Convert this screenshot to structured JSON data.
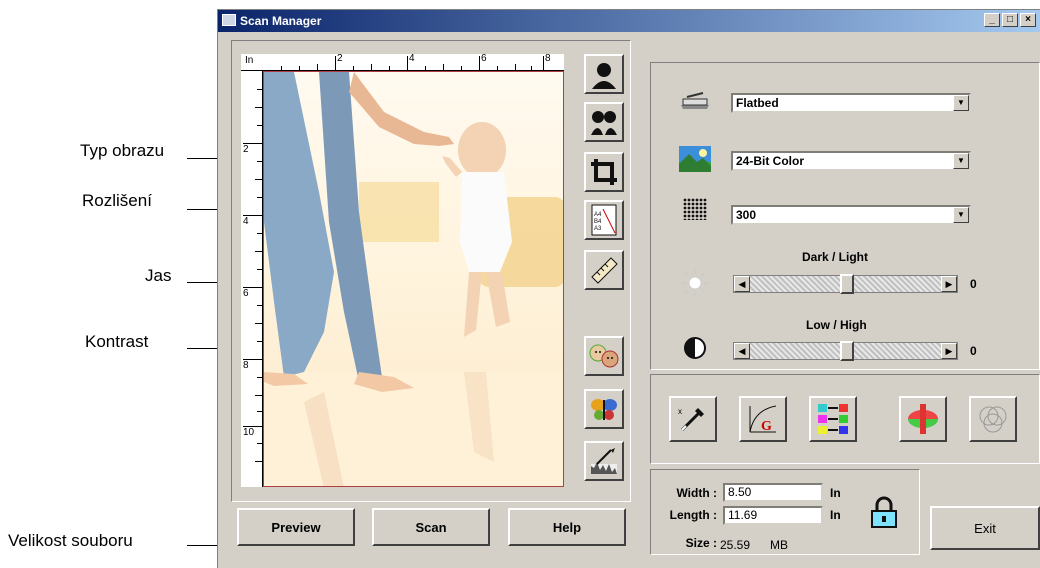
{
  "window": {
    "title": "Scan Manager",
    "controls": [
      "_",
      "□",
      "×"
    ]
  },
  "annotations": {
    "image_type": "Typ obrazu",
    "resolution": "Rozlišení",
    "brightness": "Jas",
    "contrast": "Kontrast",
    "file_size": "Velikost souboru"
  },
  "preview": {
    "ruler_unit": "In",
    "top_ruler_labels": [
      "2",
      "4",
      "6",
      "8"
    ],
    "left_ruler_labels": [
      "2",
      "4",
      "6",
      "8",
      "10"
    ]
  },
  "tools": [
    {
      "icon": "portrait-icon"
    },
    {
      "icon": "mirror-faces-icon"
    },
    {
      "icon": "crop-icon"
    },
    {
      "icon": "paper-size-icon",
      "text": "A4 B4 A3"
    },
    {
      "icon": "ruler-icon"
    },
    {
      "icon": "faces-icon"
    },
    {
      "icon": "butterfly-icon"
    },
    {
      "icon": "histogram-icon"
    }
  ],
  "settings": {
    "scan_source": "Flatbed",
    "image_type": "24-Bit Color",
    "resolution": "300",
    "brightness": {
      "label": "Dark / Light",
      "value": "0",
      "fraction": 0.5
    },
    "contrast": {
      "label": "Low / High",
      "value": "0",
      "fraction": 0.5
    }
  },
  "adjust_tools": [
    {
      "icon": "eyedropper-icon"
    },
    {
      "icon": "gamma-curve-icon",
      "text": "G"
    },
    {
      "icon": "color-balance-icon"
    },
    {
      "icon": "saturation-icon"
    },
    {
      "icon": "descreen-icon"
    }
  ],
  "size_panel": {
    "width_label": "Width :",
    "width_value": "8.50",
    "length_label": "Length :",
    "length_value": "11.69",
    "unit": "In",
    "size_label": "Size :",
    "size_value": "25.59",
    "size_unit": "MB"
  },
  "buttons": {
    "preview": "Preview",
    "scan": "Scan",
    "help": "Help",
    "exit": "Exit"
  }
}
